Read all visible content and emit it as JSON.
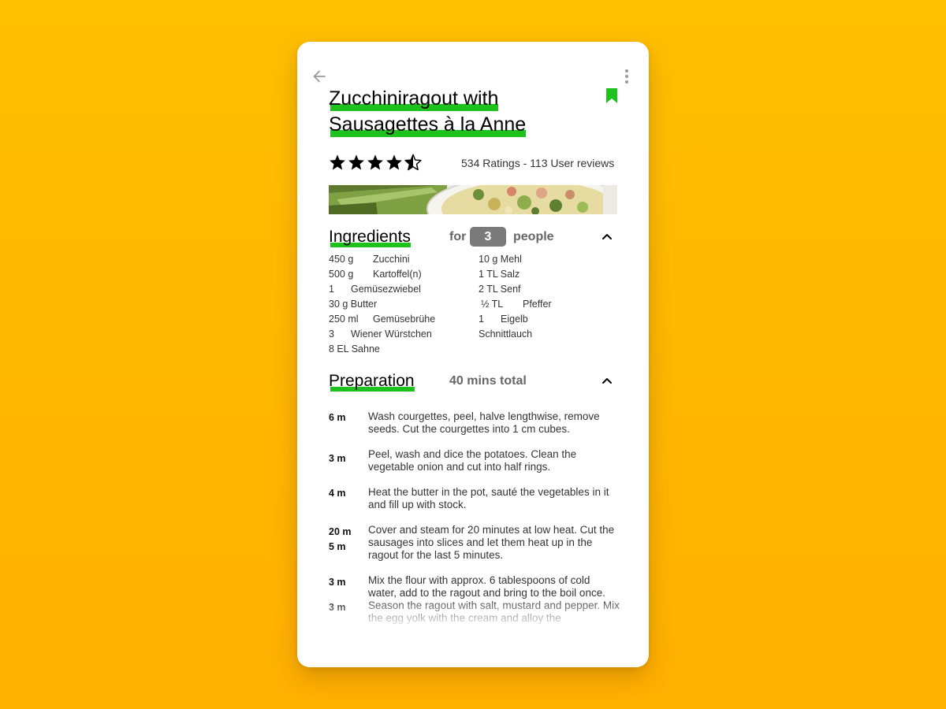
{
  "recipe": {
    "title_line1": "Zucchiniragout with",
    "title_line2": "Sausagettes à la Anne",
    "rating_value": 4.5,
    "rating_max": 5,
    "ratings_text": "534 Ratings - 113 User reviews"
  },
  "icons": {
    "back": "arrow-left-icon",
    "more": "more-vertical-icon",
    "bookmark": "bookmark-icon",
    "collapse": "chevron-up-icon"
  },
  "colors": {
    "background": "#FFB800",
    "highlight": "#1DC21D",
    "people_box": "#7A7A7A"
  },
  "ingredients": {
    "title": "Ingredients",
    "for_label": "for",
    "people_count": "3",
    "people_label": "people",
    "left": [
      {
        "amount": "450 g",
        "name": "Zucchini"
      },
      {
        "amount": "500 g",
        "name": "Kartoffel(n)"
      },
      {
        "amount": "1",
        "name": "Gemüsezwiebel"
      },
      {
        "amount": "30 g Butter",
        "name": ""
      },
      {
        "amount": "250 ml",
        "name": "Gemüsebrühe"
      },
      {
        "amount": "3",
        "name": "Wiener Würstchen"
      },
      {
        "amount": "8 EL Sahne",
        "name": ""
      }
    ],
    "right": [
      {
        "amount": "10 g Mehl",
        "name": ""
      },
      {
        "amount": "1 TL Salz",
        "name": ""
      },
      {
        "amount": "2 TL Senf",
        "name": ""
      },
      {
        "amount": "½ TL",
        "name": "Pfeffer"
      },
      {
        "amount": "1",
        "name": "Eigelb"
      },
      {
        "amount": "Schnittlauch",
        "name": ""
      }
    ]
  },
  "preparation": {
    "title": "Preparation",
    "total_time": "40 mins total",
    "steps": [
      {
        "times": [
          "6 m"
        ],
        "text": "Wash courgettes, peel, halve lengthwise, remove seeds. Cut the courgettes into 1 cm cubes."
      },
      {
        "times": [
          "3 m"
        ],
        "text": "Peel, wash and dice the potatoes. Clean the vegetable onion and cut into half rings."
      },
      {
        "times": [
          "4 m"
        ],
        "text": "Heat the butter in the pot, sauté the vegetables in it and fill up with stock."
      },
      {
        "times": [
          "20 m",
          "5 m"
        ],
        "text": "Cover and steam for 20 minutes at low heat. Cut the sausages into slices and let them heat up in the ragout for the last 5 minutes."
      },
      {
        "times": [
          "3 m",
          "3 m"
        ],
        "text": "Mix the flour with approx. 6 tablespoons of cold water, add to the ragout and bring to the boil once. Season the ragout with salt, mustard and pepper. Mix the egg yolk with the cream and alloy the"
      }
    ]
  }
}
